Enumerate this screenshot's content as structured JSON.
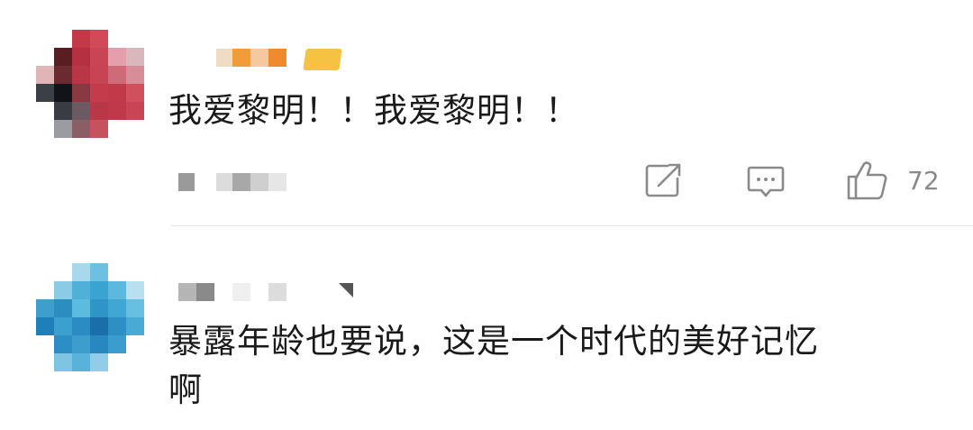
{
  "comments": [
    {
      "text": "我爱黎明！！我爱黎明！！",
      "like_count": "72",
      "avatar_style": "pixelated-red",
      "badge_color": "#f5c242"
    },
    {
      "text": "暴露年龄也要说，这是一个时代的美好记忆\n啊",
      "avatar_style": "pixelated-blue"
    }
  ],
  "icons": {
    "share": "share-icon",
    "reply": "comment-icon",
    "like": "thumbs-up-icon"
  }
}
